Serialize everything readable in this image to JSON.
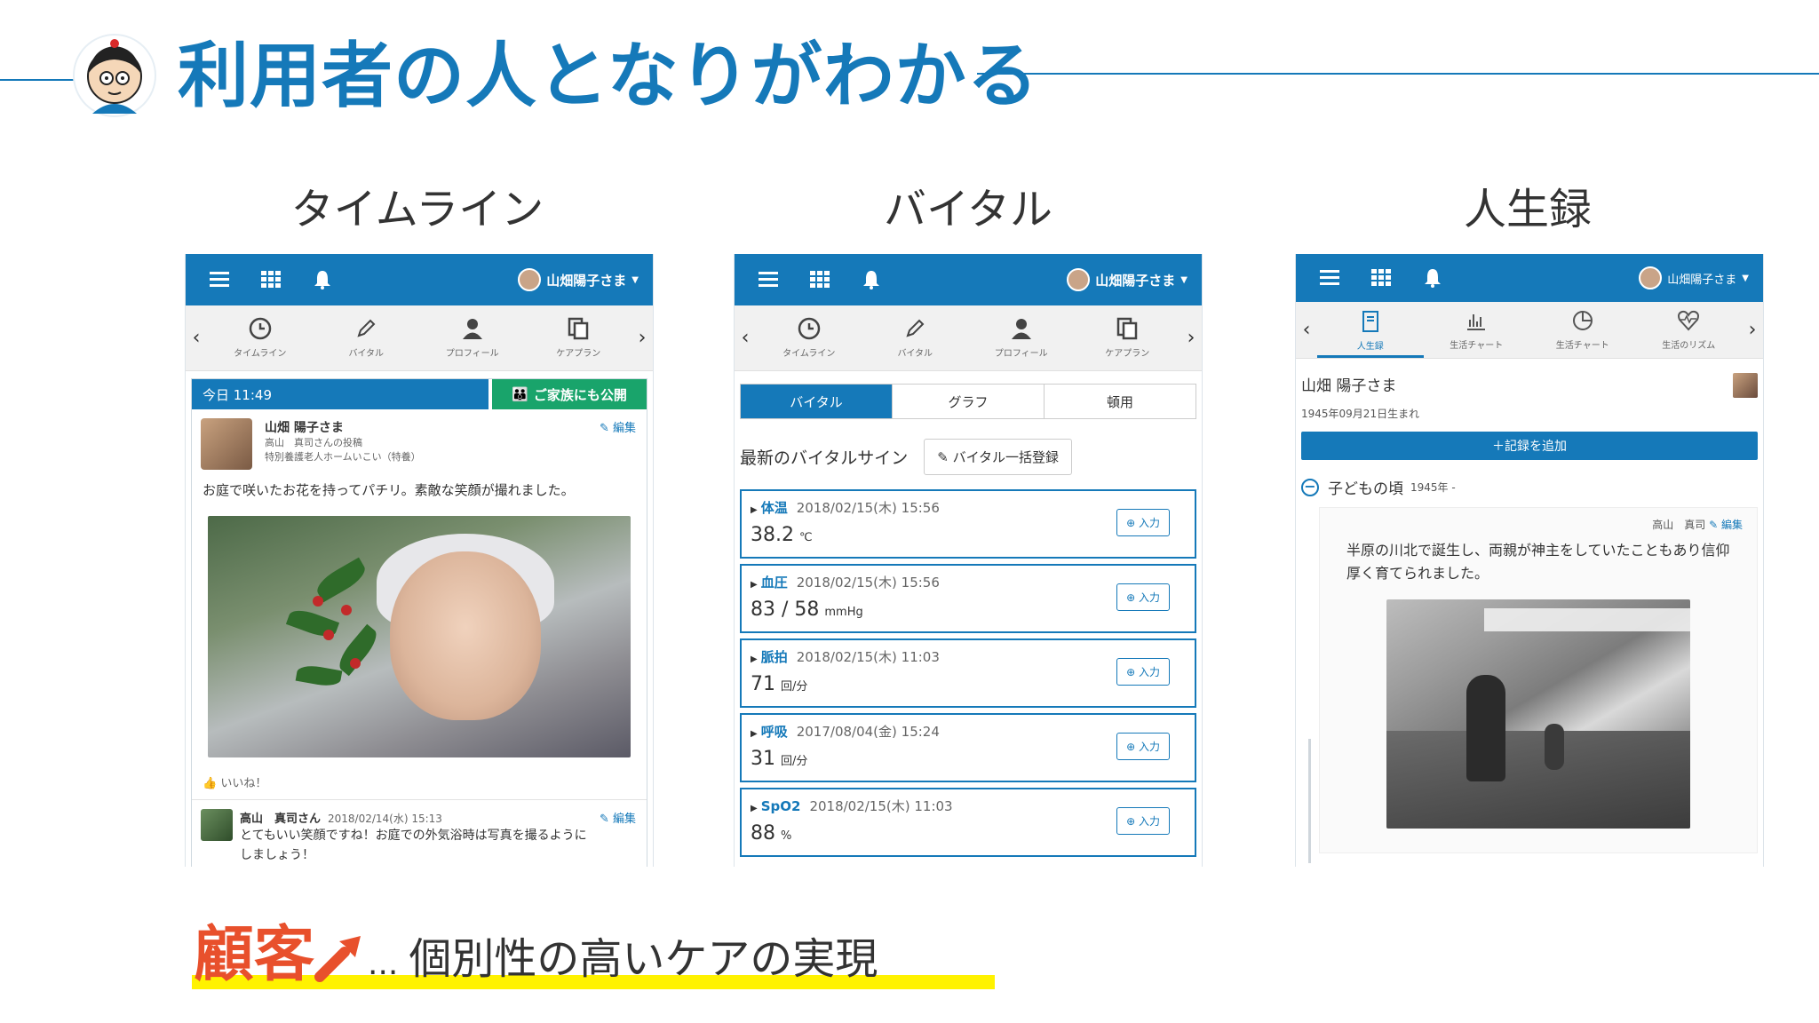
{
  "slide": {
    "title": "利用者の人となりがわかる",
    "columns": [
      "タイムライン",
      "バイタル",
      "人生録"
    ],
    "bottom_emphasis": "顧客",
    "bottom_dots": "...",
    "bottom_text": "個別性の高いケアの実現"
  },
  "colors": {
    "brand": "#1579b9",
    "green": "#19a46b",
    "accent": "#e8502c",
    "highlight": "#fff200"
  },
  "app": {
    "user": "山畑陽子さま",
    "nav": [
      "タイムライン",
      "バイタル",
      "プロフィール",
      "ケアプラン"
    ],
    "nav_lifelog": [
      "人生録",
      "生活チャート",
      "生活チャート",
      "生活のリズム"
    ],
    "nav_icons": [
      "clock-icon",
      "pen-icon",
      "person-icon",
      "document-icon"
    ]
  },
  "timeline": {
    "date": "今日 11:49",
    "publish": "ご家族にも公開",
    "poster_name": "山畑 陽子さま",
    "poster_sub1": "高山　真司さんの投稿",
    "poster_sub2": "特別養護老人ホームいこい（特養）",
    "edit": "編集",
    "text": "お庭で咲いたお花を持ってパチリ。素敵な笑顔が撮れました。",
    "like": "いいね！",
    "comment_name": "高山　真司さん",
    "comment_time": "2018/02/14(水) 15:13",
    "comment_edit": "編集",
    "comment_text": "とてもいい笑顔ですね！お庭での外気浴時は写真を撮るようにしましょう！"
  },
  "vital": {
    "tabs": [
      "バイタル",
      "グラフ",
      "頓用"
    ],
    "heading": "最新のバイタルサイン",
    "bulk_button": "バイタル一括登録",
    "input_label": "入力",
    "items": [
      {
        "name": "体温",
        "time": "2018/02/15(木) 15:56",
        "value": "38.2",
        "unit": "℃"
      },
      {
        "name": "血圧",
        "time": "2018/02/15(木) 15:56",
        "value": "83 / 58",
        "unit": "mmHg"
      },
      {
        "name": "脈拍",
        "time": "2018/02/15(木) 11:03",
        "value": "71",
        "unit": "回/分"
      },
      {
        "name": "呼吸",
        "time": "2017/08/04(金) 15:24",
        "value": "31",
        "unit": "回/分"
      },
      {
        "name": "SpO2",
        "time": "2018/02/15(木) 11:03",
        "value": "88",
        "unit": "%"
      }
    ]
  },
  "lifelog": {
    "name": "山畑 陽子さま",
    "birth": "1945年09月21日生まれ",
    "add_button": "＋記録を追加",
    "section": "子どもの頃",
    "section_year": "1945年 -",
    "meta_author": "高山　真司",
    "meta_edit": "編集",
    "text": "半原の川北で誕生し、両親が神主をしていたこともあり信仰厚く育てられました。"
  }
}
